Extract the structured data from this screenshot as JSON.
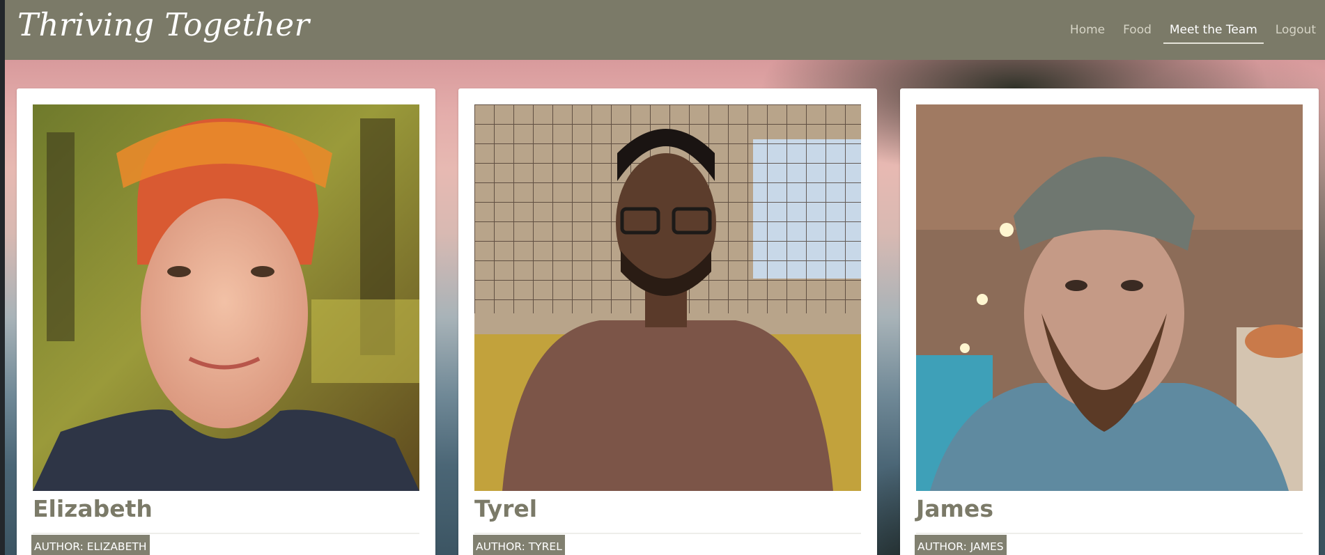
{
  "site": {
    "brand": "Thriving Together"
  },
  "nav": {
    "items": [
      {
        "label": "Home",
        "active": false
      },
      {
        "label": "Food",
        "active": false
      },
      {
        "label": "Meet the Team",
        "active": true
      },
      {
        "label": "Logout",
        "active": false
      }
    ]
  },
  "team": [
    {
      "name": "Elizabeth",
      "tag": "AUTHOR: ELIZABETH"
    },
    {
      "name": "Tyrel",
      "tag": "AUTHOR: TYREL"
    },
    {
      "name": "James",
      "tag": "AUTHOR: JAMES"
    }
  ],
  "colors": {
    "navbar": "#7b7a68",
    "accent_text": "#7b7a68",
    "card": "#ffffff"
  }
}
